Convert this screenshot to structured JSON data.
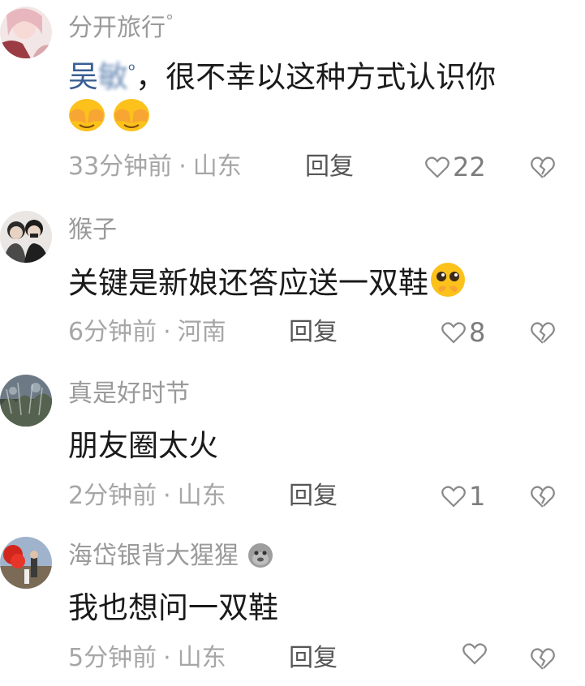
{
  "comments": [
    {
      "username": "分开旅行",
      "username_suffix": "°",
      "mention": "吴",
      "mention_blurred": "敏",
      "text": "，很不幸以这种方式认识你",
      "time": "33分钟前",
      "location": "山东",
      "reply_label": "回复",
      "likes": "22"
    },
    {
      "username": "猴子",
      "text": "关键是新娘还答应送一双鞋",
      "time": "6分钟前",
      "location": "河南",
      "reply_label": "回复",
      "likes": "8"
    },
    {
      "username": "真是好时节",
      "text": "朋友圈太火",
      "time": "2分钟前",
      "location": "山东",
      "reply_label": "回复",
      "likes": "1"
    },
    {
      "username": "海岱银背大猩猩",
      "text": "我也想问一双鞋",
      "time": "5分钟前",
      "location": "山东",
      "reply_label": "回复",
      "likes": ""
    }
  ],
  "meta_separator": "·",
  "colors": {
    "username": "#9a9a9a",
    "mention": "#3a5f93",
    "meta": "#a6a6a6",
    "text": "#1a1a1a"
  },
  "icons": [
    "heart-outline-icon",
    "broken-heart-icon",
    "search-icon",
    "covering-eyes-emoji",
    "pleading-face-emoji",
    "gorilla-emoji"
  ]
}
